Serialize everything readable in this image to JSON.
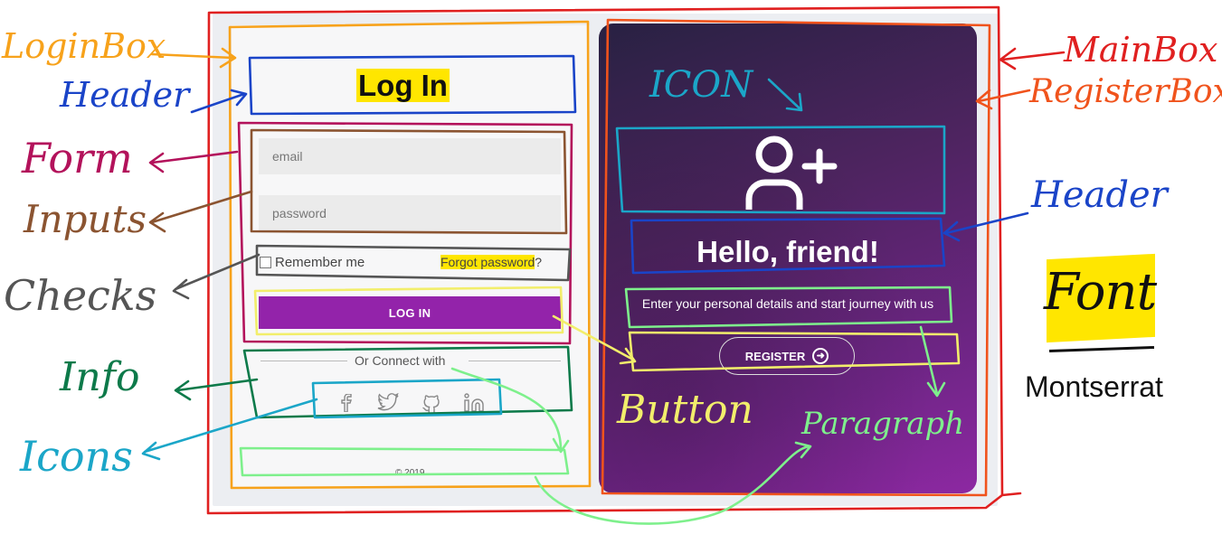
{
  "login": {
    "title": "Log In",
    "email_placeholder": "email",
    "password_placeholder": "password",
    "remember_label": "Remember me",
    "forgot_label": "Forgot password",
    "forgot_suffix": "?",
    "button_label": "LOG IN",
    "connect_text": "Or Connect with",
    "social_icons": [
      "facebook-icon",
      "twitter-icon",
      "github-icon",
      "linkedin-icon"
    ],
    "copyright": "© 2019"
  },
  "register": {
    "title": "Hello, friend!",
    "description": "Enter your personal details and start journey with us",
    "button_label": "REGISTER",
    "icon": "user-plus-icon"
  },
  "font_note": {
    "word": "Font",
    "name": "Montserrat"
  },
  "annotations": {
    "login_box": "LoginBox",
    "header_left": "Header",
    "form": "Form",
    "inputs": "Inputs",
    "checks": "Checks",
    "info": "Info",
    "icons": "Icons",
    "main_box": "MainBox",
    "register_box": "RegisterBox",
    "icon_label": "ICON",
    "header_right": "Header",
    "button": "Button",
    "paragraph": "Paragraph"
  },
  "colors": {
    "accent_purple": "#9323aa",
    "highlight_yellow": "#ffe600",
    "red": "#e02020",
    "orange": "#f7a21b",
    "orange_red": "#f0531c",
    "blue": "#1a44c8",
    "magenta": "#b3125b",
    "brown": "#8b5431",
    "gray": "#555555",
    "yellow_outline": "#f2ee6b",
    "green": "#0d7a4a",
    "cyan": "#1ba6c8",
    "light_green": "#7ef08c"
  }
}
